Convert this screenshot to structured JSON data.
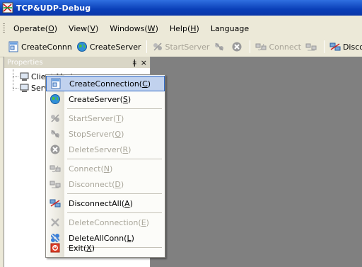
{
  "window": {
    "title": "TCP&UDP-Debug"
  },
  "menubar": {
    "items": [
      {
        "label": "Operate",
        "key": "O"
      },
      {
        "label": "View",
        "key": "V"
      },
      {
        "label": "Windows",
        "key": "W"
      },
      {
        "label": "Help",
        "key": "H"
      },
      {
        "label": "Language",
        "key": ""
      }
    ]
  },
  "toolbar": {
    "items": [
      {
        "label": "CreateConnn",
        "icon": "create-connection-icon",
        "enabled": true
      },
      {
        "label": "CreateServer",
        "icon": "globe-icon",
        "enabled": true
      },
      {
        "label": "StartServer",
        "icon": "start-server-icon",
        "enabled": false
      },
      {
        "label": "",
        "icon": "stop-server-icon",
        "enabled": false
      },
      {
        "label": "",
        "icon": "delete-server-icon",
        "enabled": false
      },
      {
        "label": "Connect",
        "icon": "connect-icon",
        "enabled": false
      },
      {
        "label": "",
        "icon": "disconnect-icon",
        "enabled": false
      },
      {
        "label": "DisconnAll",
        "icon": "disconnect-all-icon",
        "enabled": true
      }
    ]
  },
  "properties_panel": {
    "title": "Properties",
    "pin": "ǂ",
    "close": "×",
    "tree": [
      {
        "label": "Client Mode"
      },
      {
        "label": "Server Mode"
      }
    ]
  },
  "context_menu": {
    "items": [
      {
        "label": "CreateConnection",
        "key": "C",
        "enabled": true,
        "selected": true,
        "icon": "create-connection-icon"
      },
      {
        "label": "CreateServer",
        "key": "S",
        "enabled": true,
        "icon": "globe-icon"
      },
      {
        "label": "StartServer",
        "key": "T",
        "enabled": false,
        "icon": "start-server-icon"
      },
      {
        "label": "StopServer",
        "key": "O",
        "enabled": false,
        "icon": "stop-server-icon"
      },
      {
        "label": "DeleteServer",
        "key": "R",
        "enabled": false,
        "icon": "delete-server-icon"
      },
      {
        "label": "Connect",
        "key": "N",
        "enabled": false,
        "icon": "connect-icon"
      },
      {
        "label": "Disconnect",
        "key": "D",
        "enabled": false,
        "icon": "disconnect-icon"
      },
      {
        "label": "DisconnectAll",
        "key": "A",
        "enabled": true,
        "icon": "disconnect-all-icon"
      },
      {
        "label": "DeleteConnection",
        "key": "E",
        "enabled": false,
        "icon": "delete-connection-icon"
      },
      {
        "label": "DeleteAllConn",
        "key": "L",
        "enabled": true,
        "icon": "delete-all-icon"
      },
      {
        "label": "Exit",
        "key": "X",
        "enabled": true,
        "icon": "exit-icon"
      }
    ]
  },
  "colors": {
    "titlebar": "#0a3fb8",
    "workspace": "#808080",
    "menu_highlight": "#c1d2ee",
    "disabled_text": "#a9a69a"
  }
}
